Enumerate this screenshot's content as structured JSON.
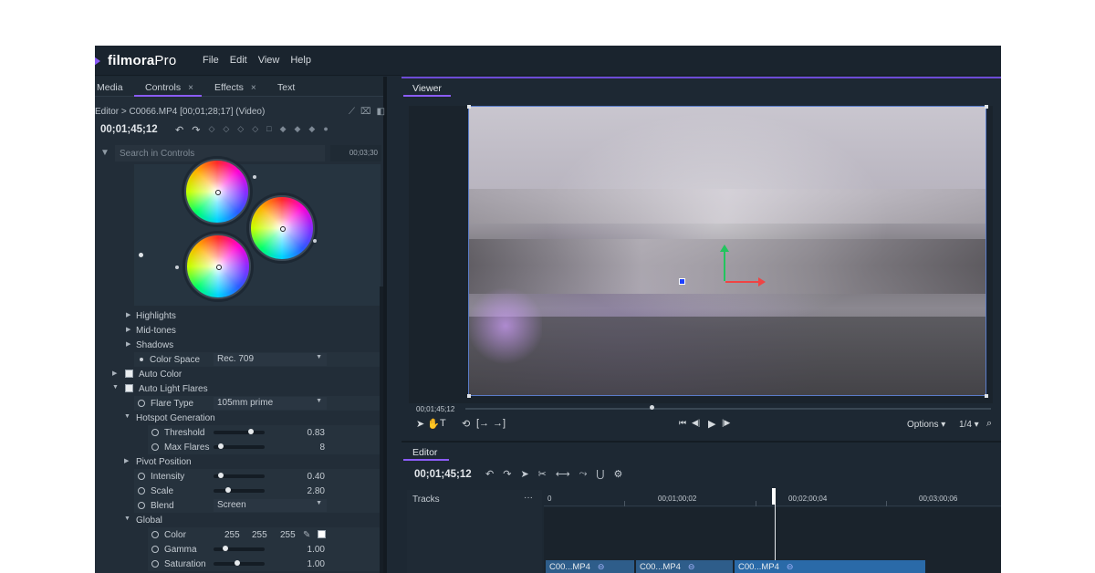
{
  "app": {
    "logo": "filmora",
    "logo_suffix": "Pro"
  },
  "menu": [
    "File",
    "Edit",
    "View",
    "Help"
  ],
  "left_tabs": [
    {
      "label": "Media",
      "closable": false
    },
    {
      "label": "Controls",
      "closable": true,
      "active": true
    },
    {
      "label": "Effects",
      "closable": true
    },
    {
      "label": "Text",
      "closable": false
    }
  ],
  "close_glyph": "×",
  "breadcrumb": "Editor > C0066.MP4 [00;01;28;17] (Video)",
  "controls_timecode": "00;01;45;12",
  "search": {
    "placeholder": "Search in Controls"
  },
  "mini_ruler_time": "00;03;30",
  "properties": {
    "highlights": "Highlights",
    "midtones": "Mid-tones",
    "shadows": "Shadows",
    "color_space": {
      "label": "Color Space",
      "value": "Rec. 709"
    },
    "auto_color": "Auto Color",
    "auto_light_flares": "Auto Light Flares",
    "flare_type": {
      "label": "Flare Type",
      "value": "105mm prime"
    },
    "hotspot_generation": "Hotspot Generation",
    "threshold": {
      "label": "Threshold",
      "value": "0.83",
      "level": 0.75
    },
    "max_flares": {
      "label": "Max Flares",
      "value": "8",
      "level": 0.1
    },
    "pivot_position": "Pivot Position",
    "intensity": {
      "label": "Intensity",
      "value": "0.40",
      "level": 0.1
    },
    "scale": {
      "label": "Scale",
      "value": "2.80",
      "level": 0.25
    },
    "blend": {
      "label": "Blend",
      "value": "Screen"
    },
    "global": "Global",
    "color": {
      "label": "Color",
      "r": "255",
      "g": "255",
      "b": "255",
      "swatch": "#ffffff"
    },
    "gamma": {
      "label": "Gamma",
      "value": "1.00",
      "level": 0.2
    },
    "saturation": {
      "label": "Saturation",
      "value": "1.00",
      "level": 0.45
    }
  },
  "viewer": {
    "tab": "Viewer",
    "timecode": "00;01;45;12",
    "progress": 0.35,
    "options_label": "Options",
    "zoom_label": "1/4"
  },
  "editor": {
    "tab": "Editor",
    "timecode": "00;01;45;12",
    "tracks_label": "Tracks",
    "tracks_menu": "···",
    "ruler": [
      "0",
      "00;01;00;02",
      "00;02;00;04",
      "00;03;00;06"
    ],
    "clips": [
      "C00...MP4",
      "C00...MP4",
      "C00...MP4"
    ]
  },
  "colors": {
    "accent": "#8b5cf6",
    "clip": "#2e5d8a",
    "panel": "#222d38"
  }
}
